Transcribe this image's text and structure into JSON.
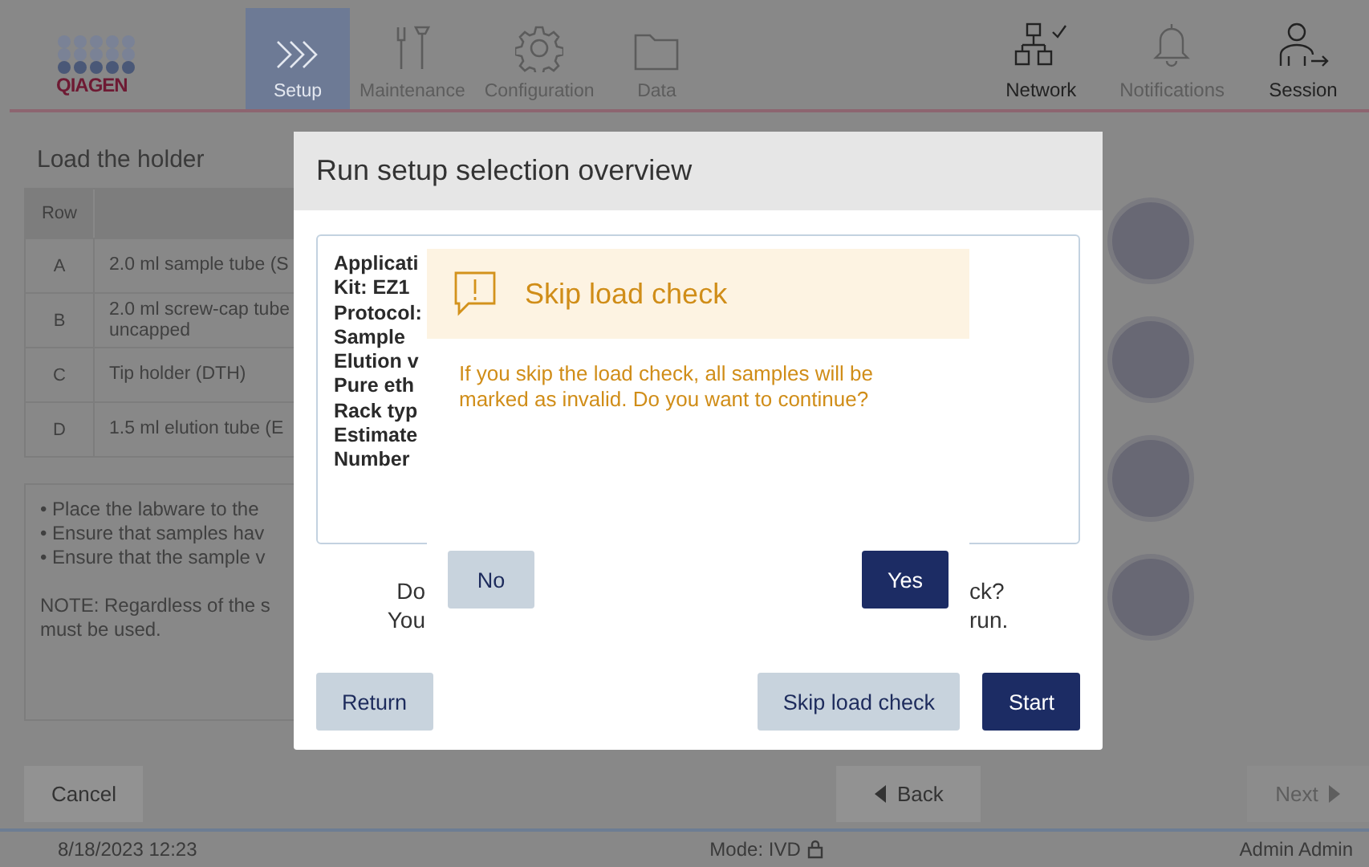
{
  "header": {
    "logo": "QIAGEN",
    "nav": [
      {
        "label": "Setup",
        "kind": "setup",
        "selected": true,
        "disabled": false
      },
      {
        "label": "Maintenance",
        "kind": "tools",
        "selected": false,
        "disabled": true
      },
      {
        "label": "Configuration",
        "kind": "gear",
        "selected": false,
        "disabled": true
      },
      {
        "label": "Data",
        "kind": "folder",
        "selected": false,
        "disabled": true
      }
    ],
    "right": [
      {
        "label": "Network",
        "kind": "network",
        "disabled": false
      },
      {
        "label": "Notifications",
        "kind": "bell",
        "disabled": true
      },
      {
        "label": "Session",
        "kind": "session",
        "disabled": false
      }
    ]
  },
  "page": {
    "title": "Load the holder",
    "table": {
      "columns": [
        "Row"
      ],
      "rows": [
        {
          "row": "A",
          "labware": [
            "2.0 ml sample tube (S"
          ]
        },
        {
          "row": "B",
          "labware": [
            "2.0 ml screw-cap tube",
            "uncapped"
          ]
        },
        {
          "row": "C",
          "labware": [
            "Tip holder (DTH)"
          ]
        },
        {
          "row": "D",
          "labware": [
            "1.5 ml elution tube (E"
          ]
        }
      ]
    },
    "instructions": [
      "• Place the labware to the",
      "• Ensure that samples hav",
      "• Ensure that the sample v"
    ],
    "note": [
      "NOTE: Regardless of the s",
      "must be used."
    ]
  },
  "footer": [
    {
      "label": "Cancel",
      "kind": "cancel",
      "disabled": false
    },
    {
      "label": "Back",
      "kind": "back",
      "disabled": false
    },
    {
      "label": "Next",
      "kind": "next",
      "disabled": true
    }
  ],
  "status_bar": {
    "datetime": "8/18/2023 12:23",
    "mode": "Mode: IVD",
    "locked": true,
    "user": "Admin Admin"
  },
  "dialog": {
    "title": "Run setup selection overview",
    "summary": [
      "Applicati",
      "Kit: EZ1",
      "Protocol:",
      "Sample",
      "Elution v",
      "Pure eth",
      "Rack typ",
      "Estimate",
      "Number"
    ],
    "question": [
      {
        "left": "Do",
        "right": "ck?"
      },
      {
        "left": "You",
        "right": "run."
      }
    ],
    "buttons": [
      {
        "label": "Return",
        "kind": "secondary"
      },
      {
        "label": "Skip load check",
        "kind": "secondary"
      },
      {
        "label": "Start",
        "kind": "primary"
      }
    ]
  },
  "alert": {
    "title": "Skip load check",
    "message": "If you skip the load check, all samples will be marked as invalid. Do you want to continue?",
    "buttons": [
      {
        "label": "No",
        "kind": "secondary"
      },
      {
        "label": "Yes",
        "kind": "primary"
      }
    ]
  }
}
